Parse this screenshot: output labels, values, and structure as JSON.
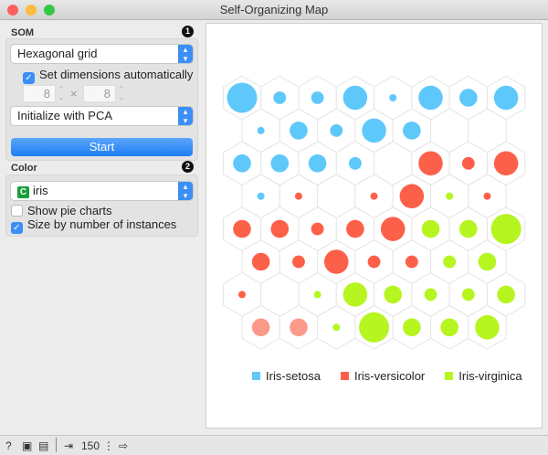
{
  "window": {
    "title": "Self-Organizing Map"
  },
  "som": {
    "section_label": "SOM",
    "badge": "1",
    "grid_type": "Hexagonal grid",
    "auto_dims_label": "Set dimensions automatically",
    "auto_dims_checked": true,
    "width": "8",
    "height": "8",
    "times": "×",
    "init": "Initialize with PCA",
    "start_label": "Start"
  },
  "color": {
    "section_label": "Color",
    "badge": "2",
    "variable": "iris",
    "variable_type": "C",
    "pie_label": "Show pie charts",
    "pie_checked": false,
    "size_label": "Size by number of instances",
    "size_checked": true
  },
  "legend": [
    {
      "label": "Iris-setosa",
      "color": "#5ec8fb"
    },
    {
      "label": "Iris-versicolor",
      "color": "#fd6049"
    },
    {
      "label": "Iris-virginica",
      "color": "#b6f520"
    }
  ],
  "light_versicolor": "#fc9a8a",
  "grid": [
    [
      [
        "B",
        17
      ],
      [
        "B",
        3
      ],
      [
        "B",
        3
      ],
      [
        "B",
        11
      ],
      [
        "B",
        1
      ],
      [
        "B",
        11
      ],
      [
        "B",
        6
      ],
      [
        "B",
        11
      ]
    ],
    [
      [
        "B",
        1
      ],
      [
        "B",
        6
      ],
      [
        "B",
        3
      ],
      [
        "B",
        11
      ],
      [
        "B",
        6
      ],
      null,
      null,
      null
    ],
    [
      [
        "B",
        6
      ],
      [
        "B",
        6
      ],
      [
        "B",
        6
      ],
      [
        "B",
        3
      ],
      null,
      [
        "R",
        11
      ],
      [
        "R",
        3
      ],
      [
        "R",
        11
      ]
    ],
    [
      [
        "B",
        1
      ],
      [
        "R",
        1
      ],
      null,
      [
        "R",
        1
      ],
      [
        "R",
        11
      ],
      [
        "G",
        1
      ],
      [
        "R",
        1
      ],
      null
    ],
    [
      [
        "R",
        6
      ],
      [
        "R",
        6
      ],
      [
        "R",
        3
      ],
      [
        "R",
        6
      ],
      [
        "R",
        11
      ],
      [
        "G",
        6
      ],
      [
        "G",
        6
      ],
      [
        "G",
        17
      ]
    ],
    [
      [
        "R",
        6
      ],
      [
        "R",
        3
      ],
      [
        "R",
        11
      ],
      [
        "R",
        3
      ],
      [
        "R",
        3
      ],
      [
        "G",
        3
      ],
      [
        "G",
        6
      ],
      null
    ],
    [
      [
        "R",
        1
      ],
      null,
      [
        "G",
        1
      ],
      [
        "G",
        11
      ],
      [
        "G",
        6
      ],
      [
        "G",
        3
      ],
      [
        "G",
        3
      ],
      [
        "G",
        6
      ]
    ],
    [
      [
        "L",
        6
      ],
      [
        "L",
        6
      ],
      [
        "G",
        1
      ],
      [
        "G",
        17
      ],
      [
        "G",
        6
      ],
      [
        "G",
        6
      ],
      [
        "G",
        11
      ],
      null
    ]
  ],
  "status": {
    "instances": "150"
  }
}
